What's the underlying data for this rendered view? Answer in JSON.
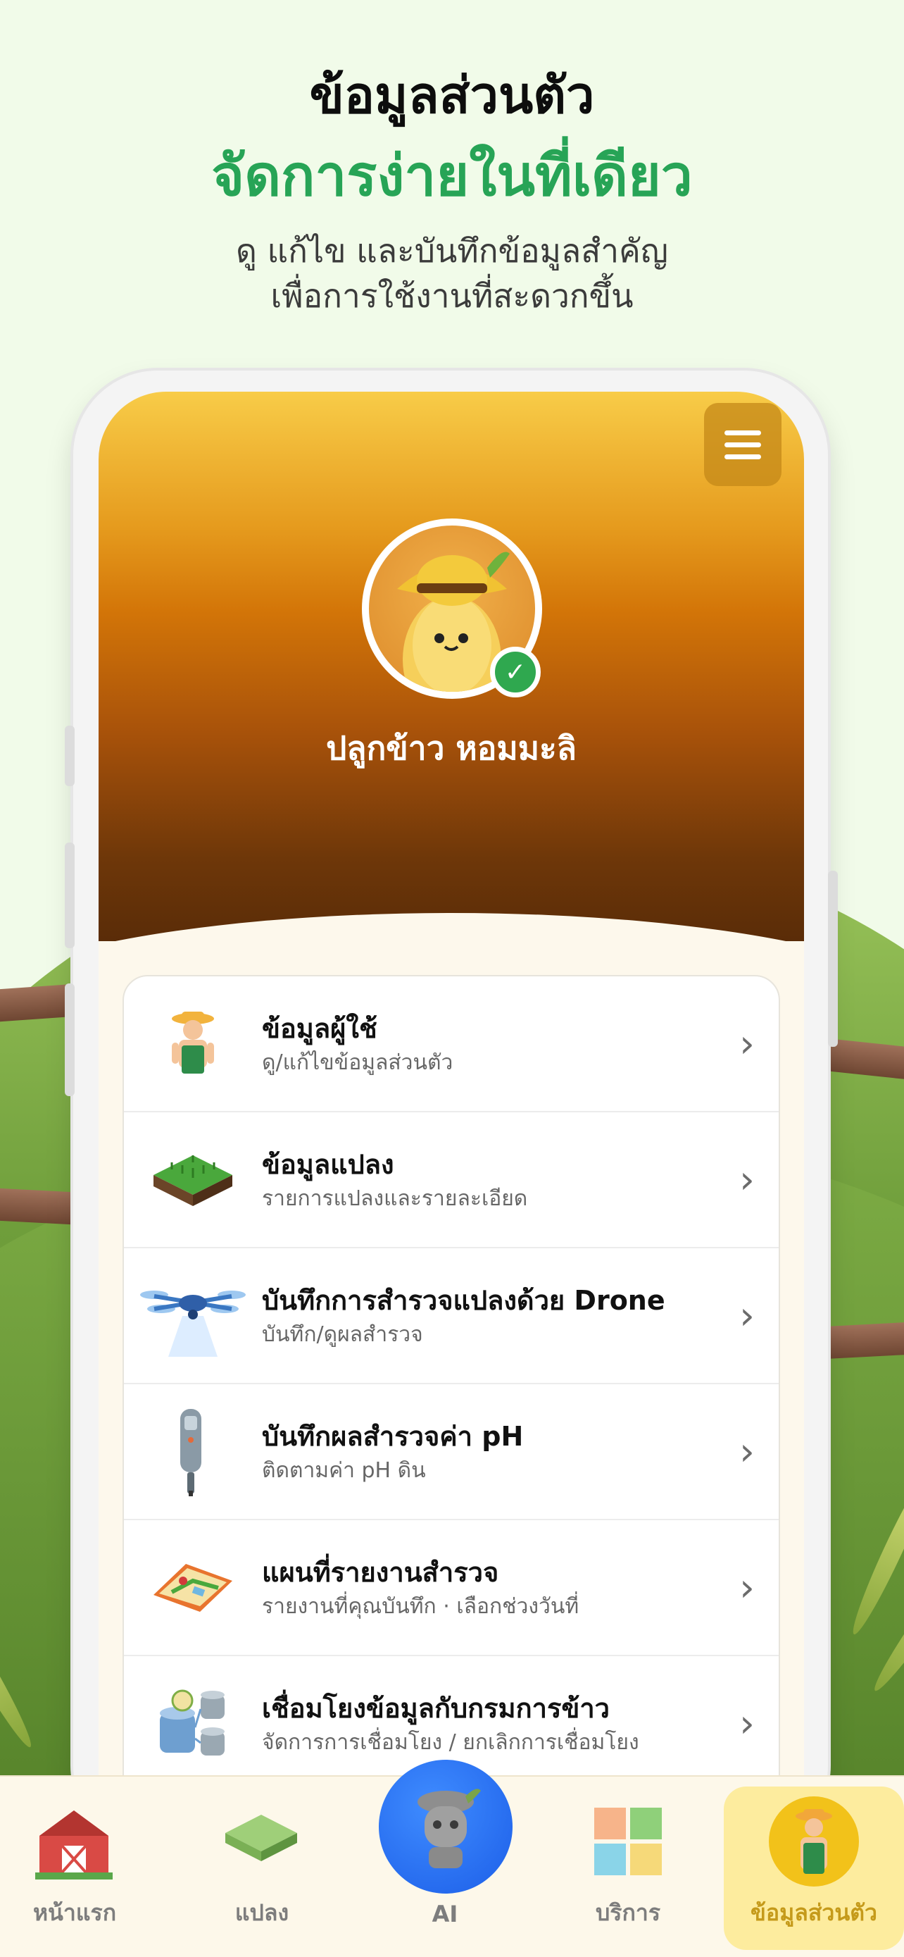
{
  "hero": {
    "title": "ข้อมูลส่วนตัว",
    "subtitle": "จัดการง่ายในที่เดียว",
    "desc_line1": "ดู แก้ไข และบันทึกข้อมูลสำคัญ",
    "desc_line2": "เพื่อการใช้งานที่สะดวกขึ้น"
  },
  "profile": {
    "name": "ปลูกข้าว หอมมะลิ",
    "verified": true
  },
  "menu_items": [
    {
      "icon": "farmer-icon",
      "title": "ข้อมูลผู้ใช้",
      "subtitle": "ดู/แก้ไขข้อมูลส่วนตัว"
    },
    {
      "icon": "field-plot-icon",
      "title": "ข้อมูลแปลง",
      "subtitle": "รายการแปลงและรายละเอียด"
    },
    {
      "icon": "drone-icon",
      "title": "บันทึกการสำรวจแปลงด้วย Drone",
      "subtitle": "บันทึก/ดูผลสำรวจ"
    },
    {
      "icon": "ph-meter-icon",
      "title": "บันทึกผลสำรวจค่า pH",
      "subtitle": "ติดตามค่า pH ดิน"
    },
    {
      "icon": "map-phone-icon",
      "title": "แผนที่รายงานสำรวจ",
      "subtitle": "รายงานที่คุณบันทึก · เลือกช่วงวันที่"
    },
    {
      "icon": "database-link-icon",
      "title": "เชื่อมโยงข้อมูลกับกรมการข้าว",
      "subtitle": "จัดการการเชื่อมโยง / ยกเลิกการเชื่อมโยง"
    }
  ],
  "bottom_nav": {
    "home": "หน้าแรก",
    "plots": "แปลง",
    "ai": "AI",
    "services": "บริการ",
    "profile": "ข้อมูลส่วนตัว",
    "active": "profile"
  },
  "colors": {
    "accent_green": "#27a456",
    "header_top": "#f8cc48",
    "header_bottom": "#5a2c08",
    "ai_blue": "#1c5ee8",
    "active_tab": "#fdec9e"
  }
}
